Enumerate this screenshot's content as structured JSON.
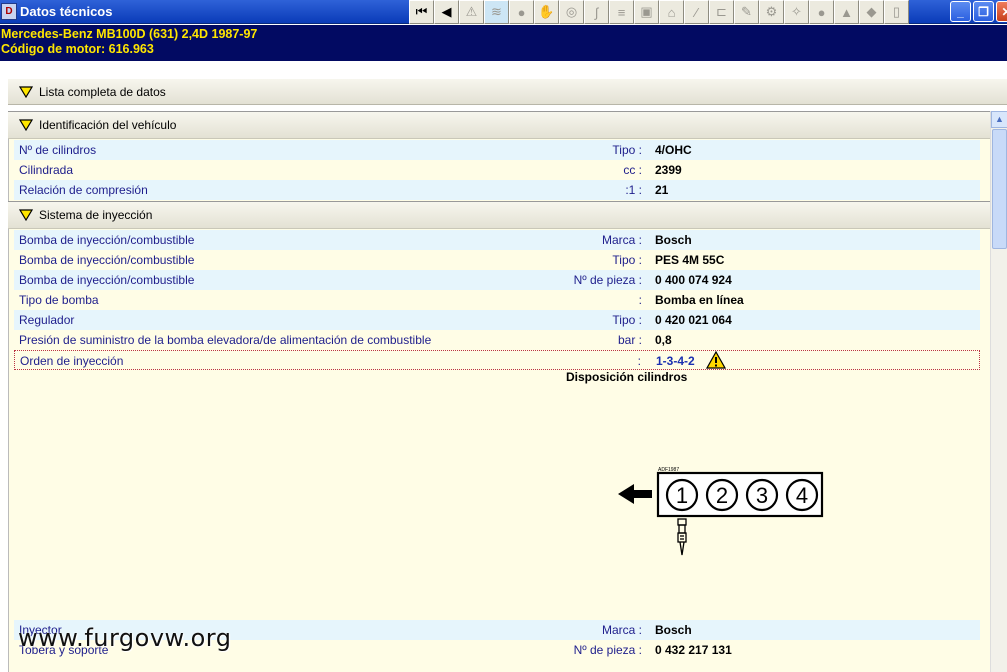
{
  "window": {
    "title": "Datos técnicos",
    "app_icon_text": "D"
  },
  "toolbar": {
    "icons": [
      "first-icon",
      "prev-icon",
      "warning-icon",
      "tech-data-icon",
      "oil-drop-icon",
      "hand-icon",
      "wheel-icon",
      "belt-icon",
      "engine-icon",
      "seat-icon",
      "lift-icon",
      "brush-icon",
      "car-icon",
      "wrench-icon",
      "gear-icon",
      "electric-icon",
      "bulb-icon",
      "caution-icon",
      "car-service-icon",
      "fuel-icon"
    ],
    "glyphs": [
      "⏮",
      "◀",
      "⚠",
      "≋",
      "●",
      "✋",
      "◎",
      "∫",
      "≡",
      "▣",
      "⌂",
      "∕",
      "⊏",
      "✎",
      "⚙",
      "✧",
      "●",
      "▲",
      "◆",
      "▯"
    ]
  },
  "window_buttons": {
    "minimize": "_",
    "restore": "❐",
    "close": "✕"
  },
  "vehicle": {
    "line1": "Mercedes-Benz   MB100D (631) 2,4D   1987-97",
    "line2": "Código de motor: 616.963"
  },
  "sections": {
    "complete": "Lista completa de datos",
    "identification": "Identificación del vehículo",
    "injection": "Sistema de inyección"
  },
  "identification_rows": [
    {
      "label": "Nº de cilindros",
      "unit": "Tipo :",
      "value": "4/OHC"
    },
    {
      "label": "Cilindrada",
      "unit": "cc :",
      "value": "2399"
    },
    {
      "label": "Relación de compresión",
      "unit": ":1 :",
      "value": "21"
    }
  ],
  "injection_rows": [
    {
      "label": "Bomba de inyección/combustible",
      "unit": "Marca :",
      "value": "Bosch"
    },
    {
      "label": "Bomba de inyección/combustible",
      "unit": "Tipo :",
      "value": "PES 4M 55C"
    },
    {
      "label": "Bomba de inyección/combustible",
      "unit": "Nº de pieza :",
      "value": "0 400 074 924"
    },
    {
      "label": "Tipo de bomba",
      "unit": ":",
      "value": "Bomba en línea"
    },
    {
      "label": "Regulador",
      "unit": "Tipo :",
      "value": "0 420 021 064"
    },
    {
      "label": "Presión de suministro de la bomba elevadora/de alimentación de combustible",
      "unit": "bar :",
      "value": "0,8"
    },
    {
      "label": "Orden de inyección",
      "unit": ":",
      "value": "1-3-4-2"
    }
  ],
  "cylinder_diagram": {
    "title": "Disposición cilindros",
    "ref_code": "ADF1987",
    "cylinders": [
      "1",
      "2",
      "3",
      "4"
    ]
  },
  "injector_rows": [
    {
      "label": "Inyector",
      "unit": "Marca :",
      "value": "Bosch"
    },
    {
      "label": "Tobera y soporte",
      "unit": "Nº de pieza :",
      "value": "0 432 217 131"
    }
  ],
  "watermark": "www.furgovw.org"
}
